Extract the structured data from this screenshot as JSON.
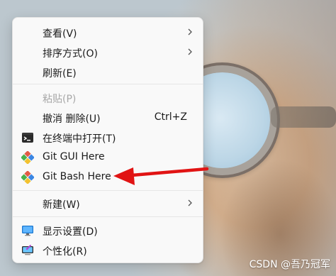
{
  "context_menu": {
    "items": [
      {
        "label": "查看(V)",
        "enabled": true,
        "has_submenu": true
      },
      {
        "label": "排序方式(O)",
        "enabled": true,
        "has_submenu": true
      },
      {
        "label": "刷新(E)",
        "enabled": true
      },
      {
        "label": "粘贴(P)",
        "enabled": false
      },
      {
        "label": "撤消 删除(U)",
        "enabled": true,
        "shortcut": "Ctrl+Z"
      },
      {
        "label": "在终端中打开(T)",
        "enabled": true,
        "icon": "terminal-icon"
      },
      {
        "label": "Git GUI Here",
        "enabled": true,
        "icon": "git-icon"
      },
      {
        "label": "Git Bash Here",
        "enabled": true,
        "icon": "git-icon"
      },
      {
        "label": "新建(W)",
        "enabled": true,
        "has_submenu": true
      },
      {
        "label": "显示设置(D)",
        "enabled": true,
        "icon": "display-settings-icon"
      },
      {
        "label": "个性化(R)",
        "enabled": true,
        "icon": "personalize-icon"
      }
    ]
  },
  "annotation": {
    "arrow_color": "#e11414",
    "points_to": "Git Bash Here"
  },
  "watermark": {
    "text": "CSDN @吾乃冠军"
  },
  "colors": {
    "menu_bg": "#f9f9f9",
    "text": "#1b1b1b",
    "disabled_text": "#a8a8a8",
    "separator": "#e6e6e6"
  }
}
